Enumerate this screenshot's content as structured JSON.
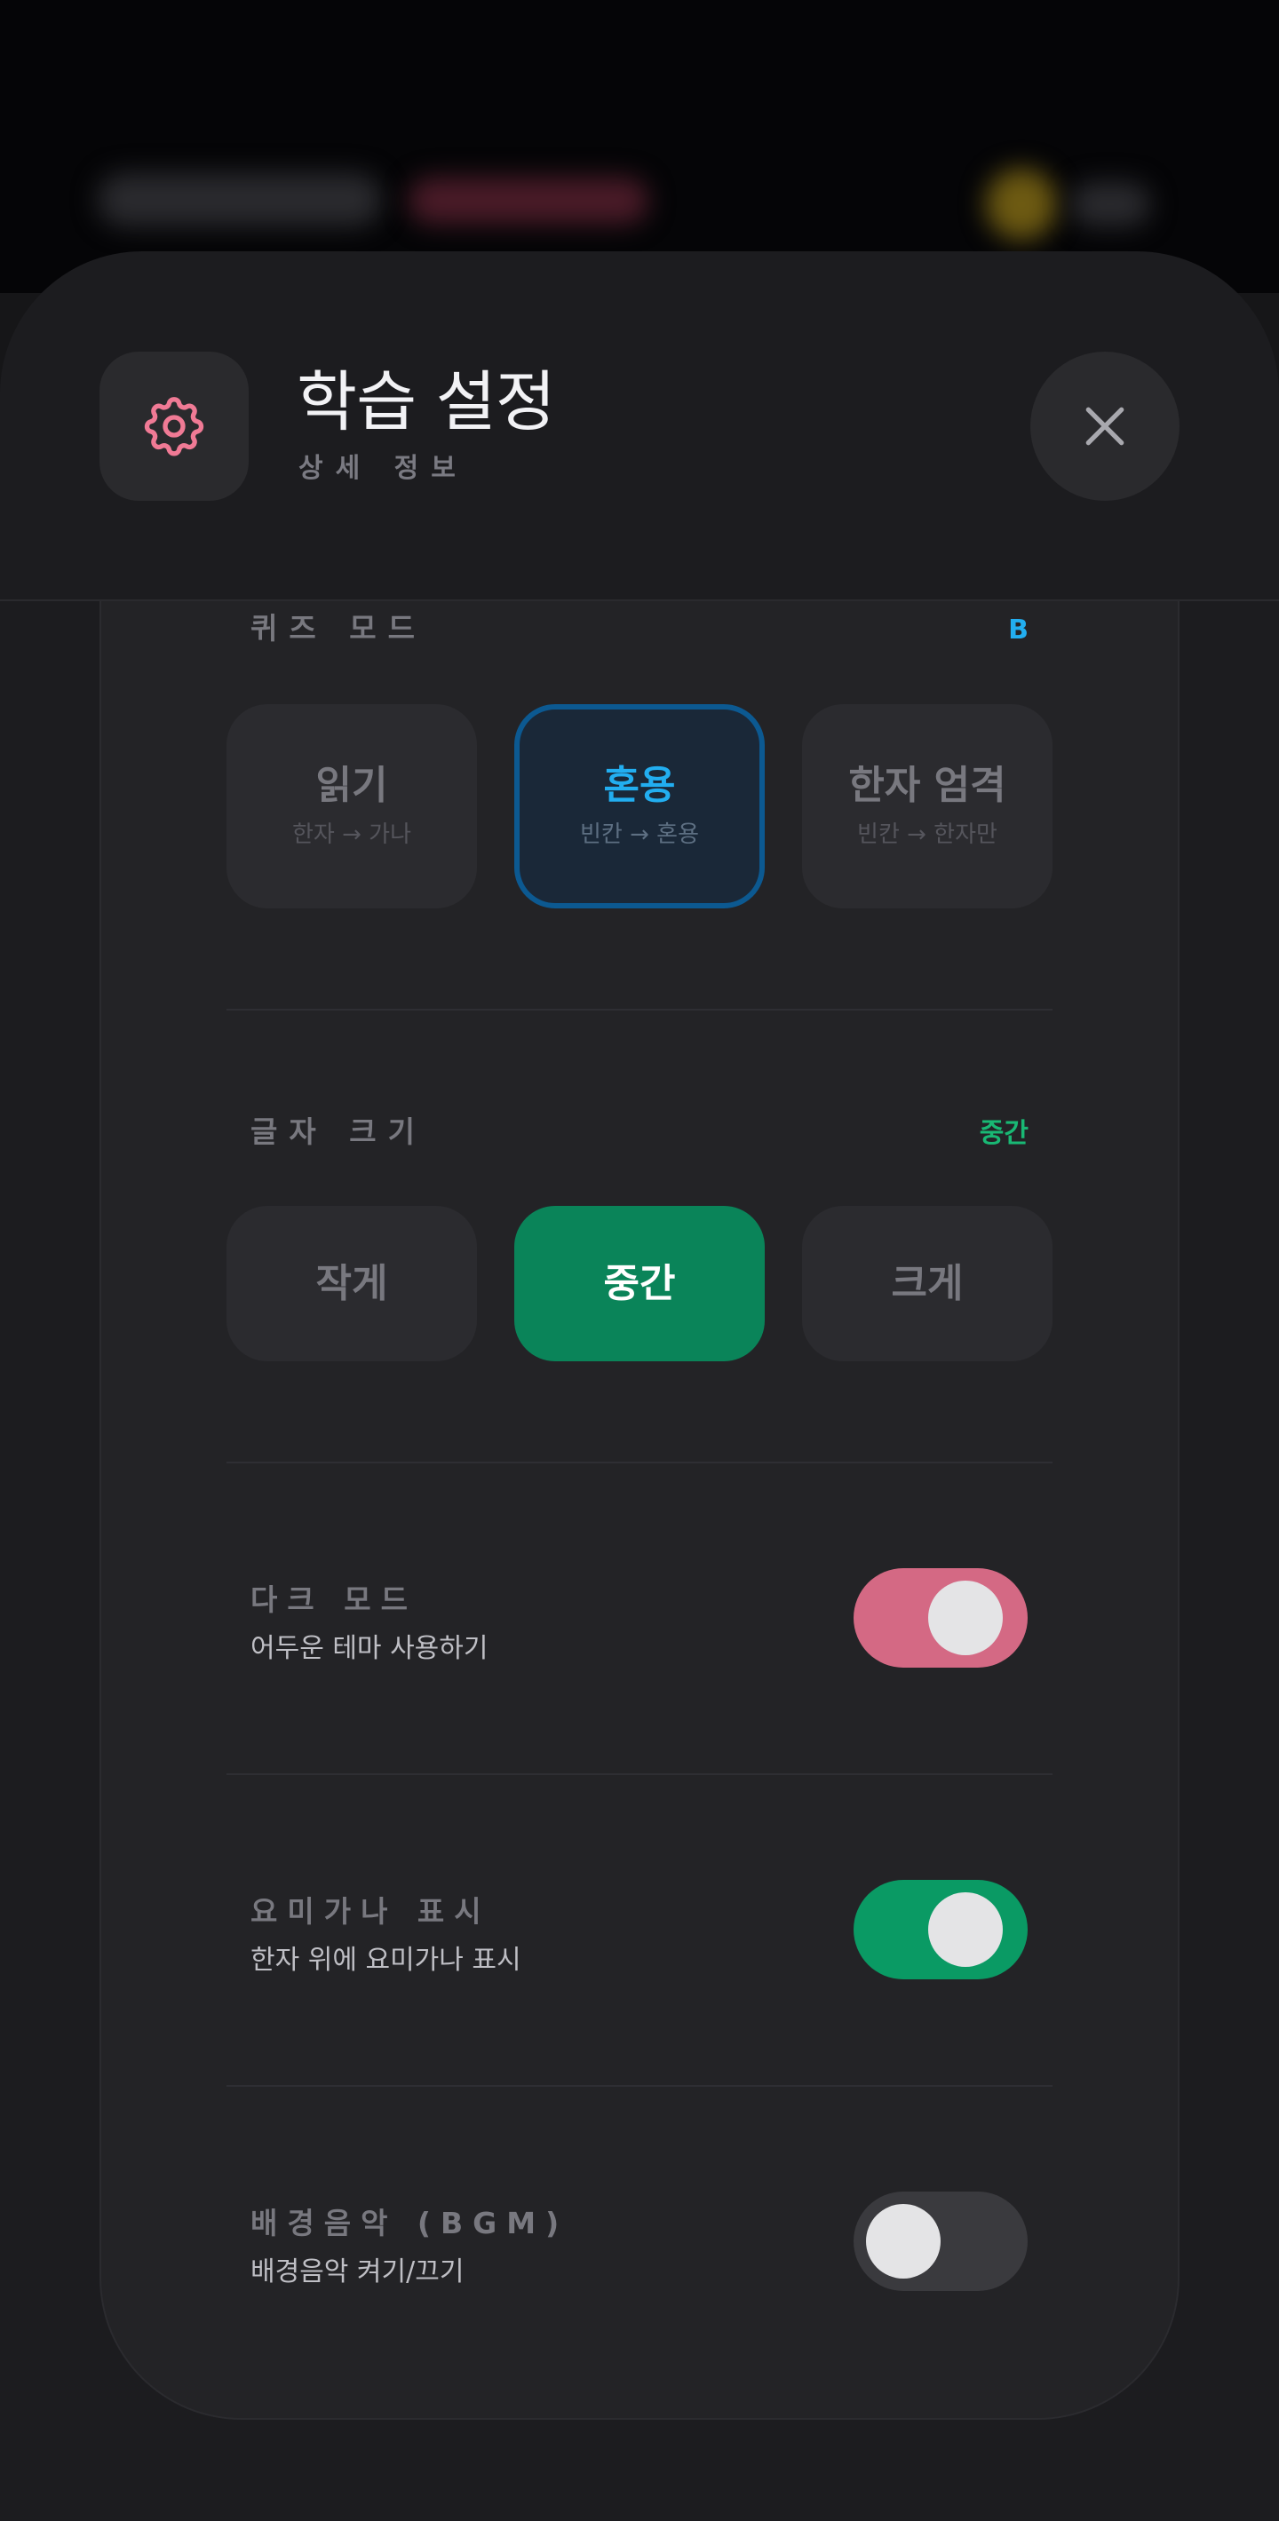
{
  "colors": {
    "accent_pink": "#d46984",
    "accent_green": "#0a8459",
    "accent_blue": "#22aef0",
    "toggle_off": "#3a3a3e"
  },
  "header": {
    "icon": "gear-icon",
    "title": "학습 설정",
    "subtitle": "상세 정보",
    "close_icon": "close-icon"
  },
  "quiz_mode": {
    "label": "퀴즈 모드",
    "badge": "B",
    "options": [
      {
        "title": "읽기",
        "sub": "한자 → 가나"
      },
      {
        "title": "혼용",
        "sub": "빈칸 → 혼용"
      },
      {
        "title": "한자 엄격",
        "sub": "빈칸 → 한자만"
      }
    ],
    "selected": 1
  },
  "font_size": {
    "label": "글자 크기",
    "badge": "중간",
    "options": [
      {
        "title": "작게"
      },
      {
        "title": "중간"
      },
      {
        "title": "크게"
      }
    ],
    "selected": 1
  },
  "settings": [
    {
      "title": "다크 모드",
      "desc": "어두운 테마 사용하기",
      "on": true,
      "color": "#d46984"
    },
    {
      "title": "요미가나 표시",
      "desc": "한자 위에 요미가나 표시",
      "on": true,
      "color": "#0a9a64"
    },
    {
      "title": "배경음악 (BGM)",
      "desc": "배경음악 켜기/끄기",
      "on": false,
      "color": "#3a3a3e"
    }
  ]
}
